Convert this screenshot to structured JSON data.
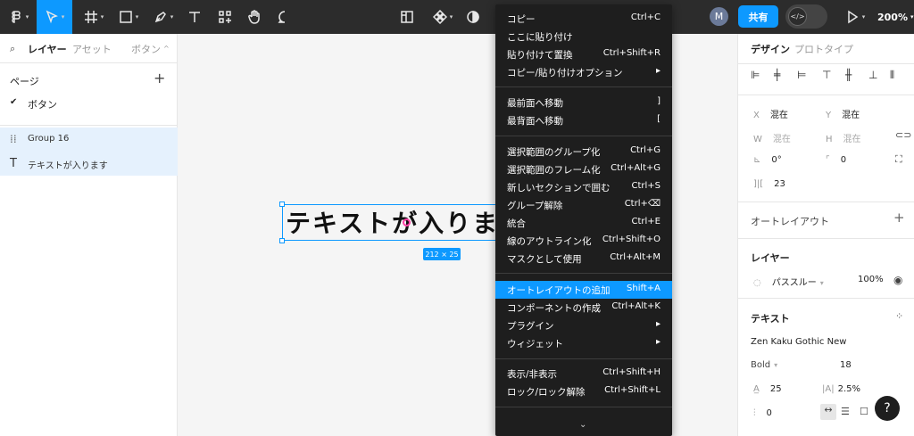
{
  "toolbar": {
    "tools": [
      {
        "name": "main-menu"
      },
      {
        "name": "move"
      },
      {
        "name": "frame"
      },
      {
        "name": "shape"
      },
      {
        "name": "pen"
      },
      {
        "name": "text"
      },
      {
        "name": "resources"
      },
      {
        "name": "hand"
      },
      {
        "name": "comment"
      }
    ],
    "avatar_initial": "M",
    "share_label": "共有",
    "zoom_label": "200%"
  },
  "left_panel": {
    "tabs": {
      "layers": "レイヤー",
      "assets": "アセット",
      "page": "ボタン"
    },
    "pages_title": "ページ",
    "pages": [
      {
        "name": "ボタン",
        "selected": true
      }
    ],
    "layers": [
      {
        "name": "Group 16",
        "icon": "group-icon"
      },
      {
        "name": "テキストが入ります",
        "icon": "text-icon"
      }
    ]
  },
  "canvas": {
    "text": "テキストが入りま",
    "size_label": "212 × 25"
  },
  "context_menu": {
    "items": [
      {
        "label": "コピー",
        "shortcut": "Ctrl+C"
      },
      {
        "label": "ここに貼り付け",
        "shortcut": ""
      },
      {
        "label": "貼り付けて置換",
        "shortcut": "Ctrl+Shift+R"
      },
      {
        "label": "コピー/貼り付けオプション",
        "shortcut": "▸"
      },
      {
        "label": "最前面へ移動",
        "shortcut": "]"
      },
      {
        "label": "最背面へ移動",
        "shortcut": "["
      },
      {
        "label": "選択範囲のグループ化",
        "shortcut": "Ctrl+G"
      },
      {
        "label": "選択範囲のフレーム化",
        "shortcut": "Ctrl+Alt+G"
      },
      {
        "label": "新しいセクションで囲む",
        "shortcut": "Ctrl+S"
      },
      {
        "label": "グループ解除",
        "shortcut": "Ctrl+⌫"
      },
      {
        "label": "統合",
        "shortcut": "Ctrl+E"
      },
      {
        "label": "線のアウトライン化",
        "shortcut": "Ctrl+Shift+O"
      },
      {
        "label": "マスクとして使用",
        "shortcut": "Ctrl+Alt+M"
      },
      {
        "label": "オートレイアウトの追加",
        "shortcut": "Shift+A"
      },
      {
        "label": "コンポーネントの作成",
        "shortcut": "Ctrl+Alt+K"
      },
      {
        "label": "プラグイン",
        "shortcut": "▸"
      },
      {
        "label": "ウィジェット",
        "shortcut": "▸"
      },
      {
        "label": "表示/非表示",
        "shortcut": "Ctrl+Shift+H"
      },
      {
        "label": "ロック/ロック解除",
        "shortcut": "Ctrl+Shift+L"
      }
    ],
    "more_chevron": "⌄"
  },
  "right_panel": {
    "tabs": {
      "design": "デザイン",
      "prototype": "プロトタイプ"
    },
    "x_label": "X",
    "x_value": "混在",
    "y_label": "Y",
    "y_value": "混在",
    "w_label": "W",
    "w_value": "混在",
    "h_label": "H",
    "h_value": "混在",
    "rotation": "0°",
    "radius": "0",
    "spacing": "23",
    "auto_layout_title": "オートレイアウト",
    "layer_title": "レイヤー",
    "blend_mode": "パススルー",
    "opacity": "100%",
    "text_title": "テキスト",
    "font_family": "Zen Kaku Gothic New",
    "font_weight": "Bold",
    "font_size": "18",
    "line_height": "25",
    "letter_spacing": "2.5%",
    "paragraph_spacing": "0"
  },
  "help_label": "?",
  "colors": {
    "accent": "#0d99ff",
    "toolbar_bg": "#2c2c2c",
    "menu_bg": "#1e1e1e"
  }
}
